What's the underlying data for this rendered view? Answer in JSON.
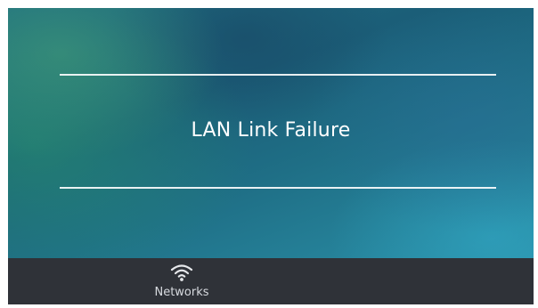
{
  "screen": {
    "message": "LAN Link Failure"
  },
  "bottom_bar": {
    "tabs": [
      {
        "label": "Networks",
        "icon": "wifi-icon"
      }
    ]
  },
  "colors": {
    "bar_background": "#2f3238",
    "text": "#ffffff",
    "rule": "#ffffff"
  }
}
